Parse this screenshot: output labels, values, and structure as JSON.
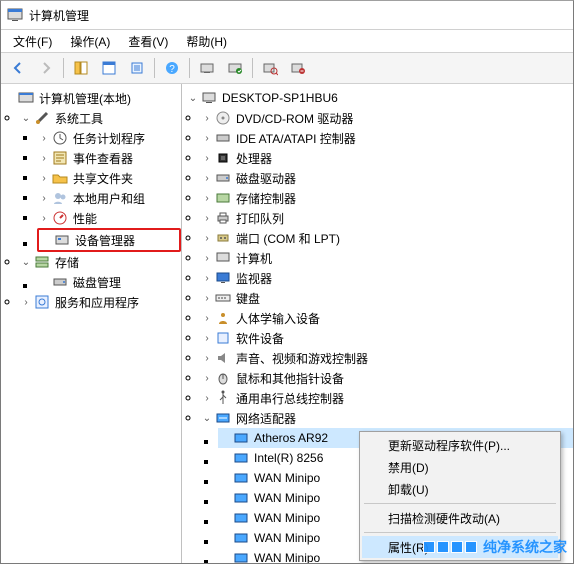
{
  "window": {
    "title": "计算机管理"
  },
  "menu": {
    "file": "文件(F)",
    "action": "操作(A)",
    "view": "查看(V)",
    "help": "帮助(H)"
  },
  "left_tree": {
    "root": "计算机管理(本地)",
    "system_tools": "系统工具",
    "task_scheduler": "任务计划程序",
    "event_viewer": "事件查看器",
    "shared_folders": "共享文件夹",
    "local_users": "本地用户和组",
    "performance": "性能",
    "device_manager": "设备管理器",
    "storage": "存储",
    "disk_mgmt": "磁盘管理",
    "services_apps": "服务和应用程序"
  },
  "right_tree": {
    "root": "DESKTOP-SP1HBU6",
    "dvd": "DVD/CD-ROM 驱动器",
    "ide": "IDE ATA/ATAPI 控制器",
    "cpu": "处理器",
    "disk_drives": "磁盘驱动器",
    "storage_ctrl": "存储控制器",
    "print_queue": "打印队列",
    "ports": "端口 (COM 和 LPT)",
    "computer": "计算机",
    "monitor": "监视器",
    "keyboard": "键盘",
    "hid": "人体学输入设备",
    "sw_devices": "软件设备",
    "sound": "声音、视频和游戏控制器",
    "mouse": "鼠标和其他指针设备",
    "usb": "通用串行总线控制器",
    "network": "网络适配器",
    "net_items": {
      "atheros": "Atheros AR92",
      "intel": "Intel(R) 8256",
      "wan1": "WAN Minipo",
      "wan2": "WAN Minipo",
      "wan3": "WAN Minipo",
      "wan4": "WAN Minipo",
      "wan5": "WAN Minipo"
    }
  },
  "context_menu": {
    "update_driver": "更新驱动程序软件(P)...",
    "disable": "禁用(D)",
    "uninstall": "卸载(U)",
    "scan_hw": "扫描检测硬件改动(A)",
    "properties": "属性(R)"
  },
  "watermark": "纯净系统之家"
}
